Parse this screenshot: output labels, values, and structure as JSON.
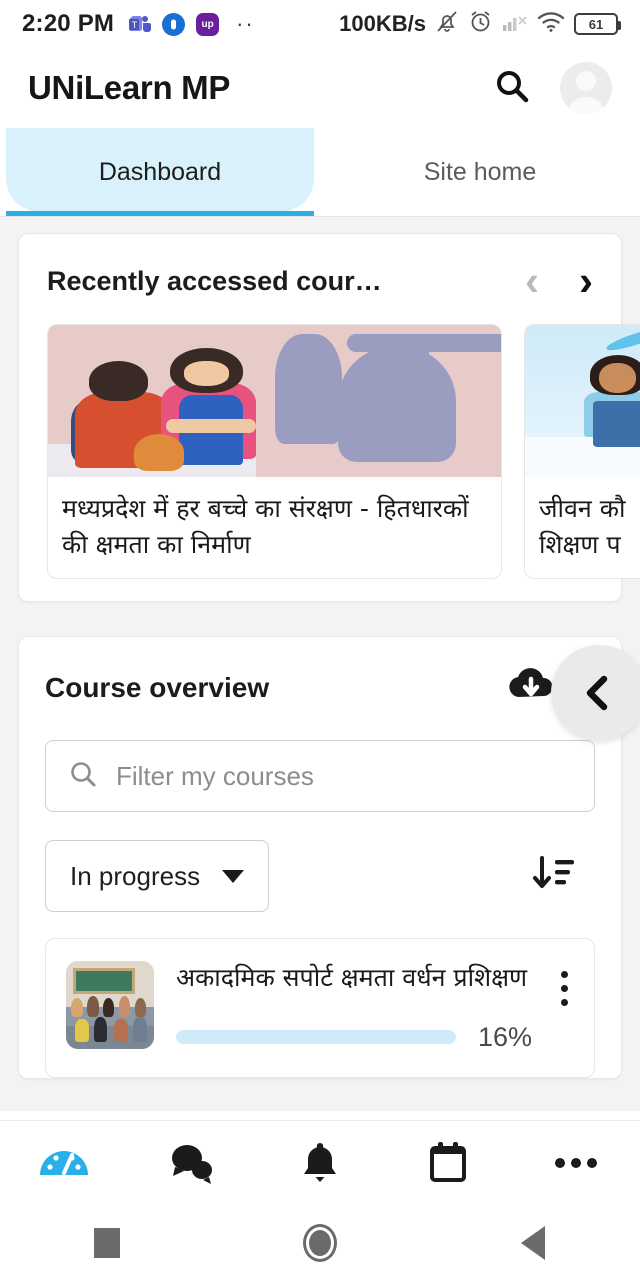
{
  "statusbar": {
    "time": "2:20 PM",
    "network_speed": "100KB/s",
    "battery_level": "61",
    "app_icons": [
      "teams-icon",
      "blue-circle-app-icon",
      "purple-up-app-icon"
    ],
    "overflow_dots": "··",
    "right_icons": [
      "mute-bell-icon",
      "alarm-clock-icon",
      "no-signal-icon",
      "wifi-icon",
      "battery-icon"
    ]
  },
  "appbar": {
    "title": "UNiLearn MP",
    "search_icon": "search-icon",
    "avatar": "user-avatar"
  },
  "tabs": [
    {
      "label": "Dashboard",
      "active": true
    },
    {
      "label": "Site home",
      "active": false
    }
  ],
  "recently_accessed": {
    "title": "Recently accessed cour…",
    "prev_label": "‹",
    "next_label": "›",
    "courses": [
      {
        "title": "मध्यप्रदेश में हर बच्चे का  संरक्षण - हितधारकों की क्षमता का निर्माण",
        "image": "child-protection-illustration"
      },
      {
        "title": "जीवन कौ\nशिक्षण प",
        "image": "school-girl-illustration"
      }
    ]
  },
  "course_overview": {
    "title": "Course overview",
    "download_icon": "cloud-download-icon",
    "filter": {
      "placeholder": "Filter my courses",
      "value": "",
      "icon": "search-icon"
    },
    "status_dropdown": {
      "selected": "In progress",
      "icon": "chevron-down-icon"
    },
    "sort_icon": "sort-descending-icon",
    "courses": [
      {
        "title": "अकादमिक सपोर्ट क्षमता वर्धन प्रशिक्षण",
        "progress_percent": 16,
        "progress_label": "16%",
        "thumbnail": "classroom-thumbnail",
        "menu_icon": "kebab-menu-icon"
      }
    ]
  },
  "floating_back_button": {
    "icon": "back-chevron-icon",
    "label": "‹"
  },
  "bottom_nav": [
    {
      "name": "dashboard",
      "icon": "gauge-icon",
      "active": true
    },
    {
      "name": "messages",
      "icon": "chat-bubbles-icon",
      "active": false
    },
    {
      "name": "notifications",
      "icon": "bell-icon",
      "active": false
    },
    {
      "name": "calendar",
      "icon": "calendar-icon",
      "active": false
    },
    {
      "name": "more",
      "icon": "more-dots-icon",
      "active": false
    }
  ],
  "system_nav": [
    {
      "name": "recents",
      "icon": "square-icon"
    },
    {
      "name": "home",
      "icon": "circle-icon"
    },
    {
      "name": "back",
      "icon": "triangle-icon"
    }
  ],
  "colors": {
    "accent": "#29b0e8",
    "tab_active_bg": "#d9f1fb",
    "progress_track": "#cfeaf8",
    "page_bg": "#f3f3f3"
  }
}
